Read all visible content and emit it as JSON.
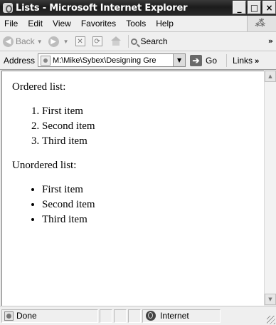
{
  "window": {
    "title": "Lists - Microsoft Internet Explorer",
    "controls": {
      "minimize": "_",
      "maximize": "□",
      "close": "×"
    }
  },
  "menubar": {
    "items": [
      "File",
      "Edit",
      "View",
      "Favorites",
      "Tools",
      "Help"
    ]
  },
  "toolbar": {
    "back_label": "Back",
    "search_label": "Search",
    "more": "»"
  },
  "addressbar": {
    "label": "Address",
    "value": "M:\\Mike\\Sybex\\Designing Gre",
    "go_label": "Go",
    "links_label": "Links",
    "links_more": "»"
  },
  "page": {
    "ordered_heading": "Ordered list:",
    "ordered_items": [
      "First item",
      "Second item",
      "Third item"
    ],
    "unordered_heading": "Unordered list:",
    "unordered_items": [
      "First item",
      "Second item",
      "Third item"
    ]
  },
  "statusbar": {
    "status_text": "Done",
    "zone_text": "Internet"
  },
  "icons": {
    "app": "ie-page-icon",
    "throbber": "windows-logo-icon",
    "back": "back-arrow-icon",
    "forward": "forward-arrow-icon",
    "stop": "stop-icon",
    "refresh": "refresh-icon",
    "home": "home-icon",
    "search": "search-icon",
    "go": "go-arrow-icon",
    "zone": "globe-icon"
  }
}
